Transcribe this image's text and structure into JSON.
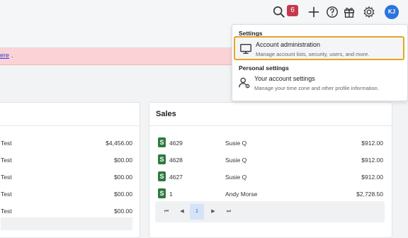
{
  "header": {
    "notification_count": "6",
    "avatar_initials": "KJ",
    "icons": [
      "search-icon",
      "plus-icon",
      "help-icon",
      "gift-icon",
      "gear-icon"
    ]
  },
  "notice": {
    "link_text": "ere"
  },
  "left_card": {
    "rows": [
      {
        "name": "Test",
        "amount": "$4,456.00"
      },
      {
        "name": "Test",
        "amount": "$00.00"
      },
      {
        "name": "Test",
        "amount": "$00.00"
      },
      {
        "name": "Test",
        "amount": "$00.00"
      },
      {
        "name": "Test",
        "amount": "$00.00"
      }
    ]
  },
  "sales": {
    "title": "Sales",
    "rows": [
      {
        "icon": "S",
        "number": "4629",
        "customer": "Susie Q",
        "amount": "$912.00"
      },
      {
        "icon": "S",
        "number": "4628",
        "customer": "Susie Q",
        "amount": "$912.00"
      },
      {
        "icon": "S",
        "number": "4627",
        "customer": "Susie Q",
        "amount": "$912.00"
      },
      {
        "icon": "S",
        "number": "1",
        "customer": "Andy Morse",
        "amount": "$2,728.50"
      }
    ],
    "pager": {
      "first": "⏮",
      "prev": "◀",
      "page": "1",
      "next": "▶",
      "last": "⏭"
    }
  },
  "settings_menu": {
    "section_settings": "Settings",
    "account_admin": {
      "title": "Account administration",
      "description": "Manage account lists, security, users, and more."
    },
    "section_personal": "Personal settings",
    "your_account": {
      "title": "Your account settings",
      "description": "Manage your time zone and other profile information."
    }
  },
  "colors": {
    "badge": "#c43a4d",
    "avatar": "#2c74de",
    "notice_bg": "#fbd3d6",
    "selected_outline": "#e5a620",
    "sale_icon": "#2f7a3e"
  }
}
